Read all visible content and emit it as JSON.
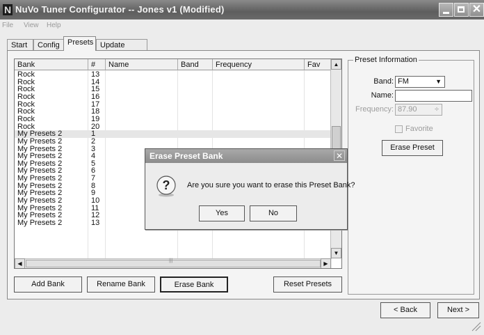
{
  "window": {
    "title": "NuVo Tuner Configurator -- Jones v1 (Modified)",
    "close_glyph": "✕"
  },
  "menu": [
    "File",
    "View",
    "Help"
  ],
  "tabs": [
    "Start",
    "Config",
    "Presets",
    "Update System"
  ],
  "active_tab": "Presets",
  "grid": {
    "columns": [
      "Bank",
      "#",
      "Name",
      "Band",
      "Frequency",
      "Fav"
    ],
    "rows": [
      [
        "Rock",
        "13"
      ],
      [
        "Rock",
        "14"
      ],
      [
        "Rock",
        "15"
      ],
      [
        "Rock",
        "16"
      ],
      [
        "Rock",
        "17"
      ],
      [
        "Rock",
        "18"
      ],
      [
        "Rock",
        "19"
      ],
      [
        "Rock",
        "20"
      ],
      [
        "My Presets 2",
        "1"
      ],
      [
        "My Presets 2",
        "2"
      ],
      [
        "My Presets 2",
        "3"
      ],
      [
        "My Presets 2",
        "4"
      ],
      [
        "My Presets 2",
        "5"
      ],
      [
        "My Presets 2",
        "6"
      ],
      [
        "My Presets 2",
        "7"
      ],
      [
        "My Presets 2",
        "8"
      ],
      [
        "My Presets 2",
        "9"
      ],
      [
        "My Presets 2",
        "10"
      ],
      [
        "My Presets 2",
        "11"
      ],
      [
        "My Presets 2",
        "12"
      ],
      [
        "My Presets 2",
        "13"
      ]
    ],
    "selected_row": 8,
    "scroll_glyphs": {
      "up": "▲",
      "down": "▼",
      "left": "◀",
      "right": "▶"
    }
  },
  "buttons": {
    "add_bank": "Add Bank",
    "rename_bank": "Rename Bank",
    "erase_bank": "Erase Bank",
    "reset_presets": "Reset Presets",
    "back": "< Back",
    "next": "Next >"
  },
  "preset_info": {
    "title": "Preset Information",
    "band_label": "Band:",
    "band_value": "FM",
    "name_label": "Name:",
    "name_value": "",
    "frequency_label": "Frequency:",
    "frequency_value": "87.90",
    "spin_glyph": "÷",
    "favorite_label": "Favorite",
    "erase_preset": "Erase Preset"
  },
  "dialog": {
    "title": "Erase Preset Bank",
    "message": "Are you sure you want to erase this Preset Bank?",
    "yes": "Yes",
    "no": "No",
    "icon_glyph": "?",
    "close_glyph": "✕"
  }
}
